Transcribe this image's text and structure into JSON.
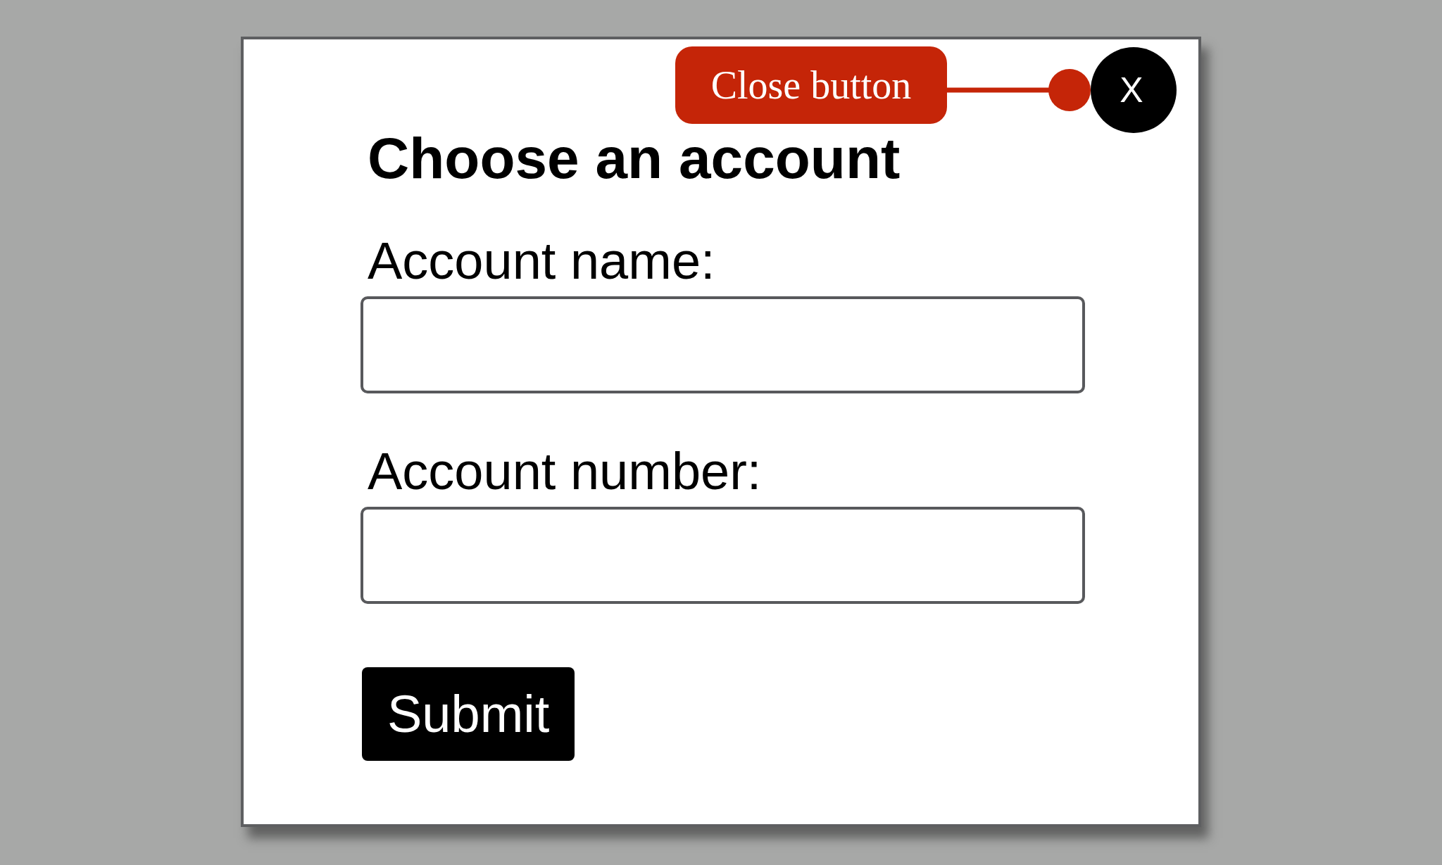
{
  "dialog": {
    "title": "Choose an account",
    "close_button": {
      "label": "X"
    },
    "fields": [
      {
        "label": "Account name:"
      },
      {
        "label": "Account number:"
      }
    ],
    "submit_button": {
      "label": "Submit"
    }
  },
  "annotation": {
    "label": "Close button"
  }
}
